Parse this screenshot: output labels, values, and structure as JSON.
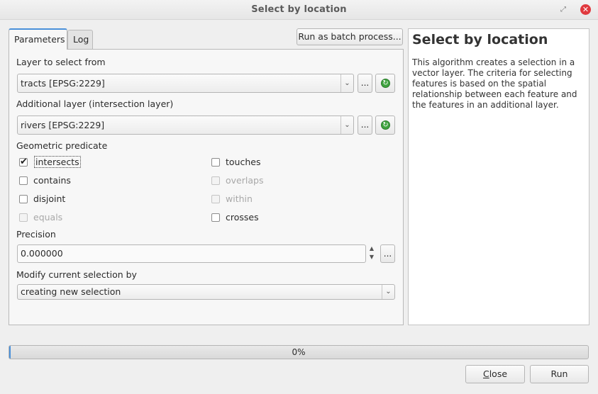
{
  "window": {
    "title": "Select by location",
    "restore_glyph": "⤢",
    "close_glyph": "✕"
  },
  "tabs": {
    "parameters": "Parameters",
    "log": "Log"
  },
  "batch_button": "Run as batch process...",
  "params": {
    "layer_label": "Layer to select from",
    "layer_value": "tracts [EPSG:2229]",
    "intersect_label": "Additional layer (intersection layer)",
    "intersect_value": "rivers [EPSG:2229]",
    "ellipsis": "...",
    "predicate_label": "Geometric predicate",
    "predicates": {
      "intersects": {
        "label": "intersects",
        "checked": true,
        "enabled": true
      },
      "touches": {
        "label": "touches",
        "checked": false,
        "enabled": true
      },
      "contains": {
        "label": "contains",
        "checked": false,
        "enabled": true
      },
      "overlaps": {
        "label": "overlaps",
        "checked": false,
        "enabled": false
      },
      "disjoint": {
        "label": "disjoint",
        "checked": false,
        "enabled": true
      },
      "within": {
        "label": "within",
        "checked": false,
        "enabled": false
      },
      "equals": {
        "label": "equals",
        "checked": false,
        "enabled": false
      },
      "crosses": {
        "label": "crosses",
        "checked": false,
        "enabled": true
      }
    },
    "precision_label": "Precision",
    "precision_value": "0.000000",
    "modify_label": "Modify current selection by",
    "modify_value": "creating new selection"
  },
  "help": {
    "title": "Select by location",
    "text": "This algorithm creates a selection in a vector layer. The criteria for selecting features is based on the spatial relationship between each feature and the features in an additional layer."
  },
  "progress": {
    "value": 0.0,
    "text": "0%"
  },
  "footer": {
    "close_first": "C",
    "close_rest": "lose",
    "run": "Run"
  },
  "colors": {
    "accent": "#4a90d9",
    "close_red": "#e0393e",
    "refresh_green": "#3fa33f"
  }
}
